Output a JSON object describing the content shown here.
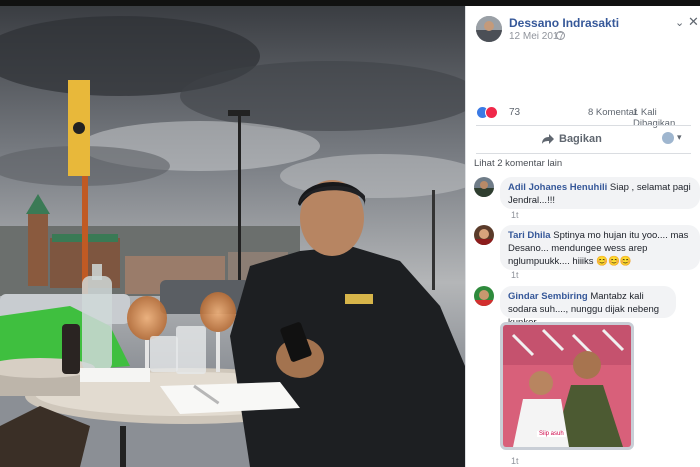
{
  "post": {
    "author": "Dessano Indrasakti",
    "date": "12 Mei 2017",
    "reaction_count": "73",
    "comments_count": "8 Komentar",
    "shares_count": "1 Kali Dibagikan",
    "share_label": "Bagikan",
    "more_comments": "Lihat 2 komentar lain"
  },
  "comments": [
    {
      "name": "Adil Johanes Henuhili",
      "text": " Siap , selamat pagi Jendral...!!!",
      "time": "1t"
    },
    {
      "name": "Tari Dhila",
      "text": " Sptinya mo hujan itu yoo.... mas Desano... mendungee wess arep nglumpuukk.... hiiiks 😊😊😊",
      "time": "1t"
    },
    {
      "name": "Gindar Sembiring",
      "text": " Mantabz kali sodara suh...., nunggu dijak nebeng kunker...",
      "time": "1t",
      "photo_caption": "Siip asuh"
    }
  ],
  "icons": {
    "menu": "chevron-down-icon",
    "close": "close-icon",
    "privacy": "globe-icon",
    "like": "like-reaction-icon",
    "love": "love-reaction-icon",
    "share": "share-icon",
    "audience": "audience-selector-icon"
  },
  "colors": {
    "link": "#365899",
    "like": "#3b7ae4",
    "love": "#f0284a",
    "bubble": "#f2f3f5"
  }
}
